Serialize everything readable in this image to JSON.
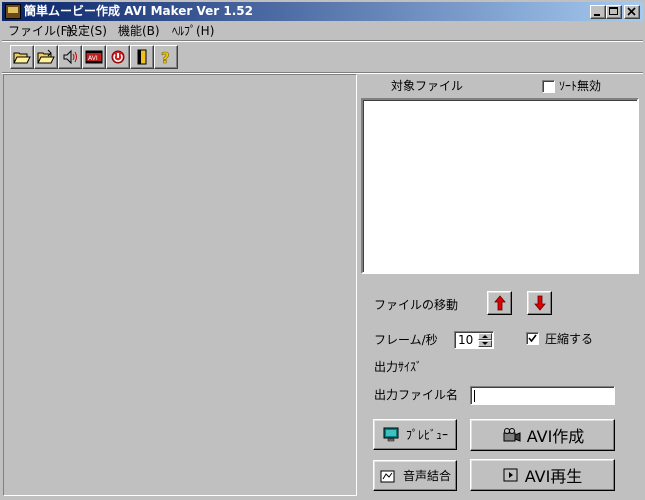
{
  "window": {
    "title": "簡単ムービー作成  AVI Maker Ver 1.52",
    "controls": {
      "minimize": "_",
      "maximize": "□",
      "close": "×"
    }
  },
  "menu": [
    {
      "label": "ファイル(F)",
      "name": "menu-file"
    },
    {
      "label": "設定(S)",
      "name": "menu-settings"
    },
    {
      "label": "機能(B)",
      "name": "menu-function"
    },
    {
      "label": "ﾍﾙﾌﾟ(H)",
      "name": "menu-help"
    }
  ],
  "toolbar": [
    {
      "icon": "open-folder-icon"
    },
    {
      "icon": "open-folder-alt-icon"
    },
    {
      "icon": "speaker-icon"
    },
    {
      "icon": "film-avi-icon"
    },
    {
      "icon": "reset-icon"
    },
    {
      "icon": "exit-door-icon"
    },
    {
      "icon": "help-question-icon"
    }
  ],
  "file_list": {
    "header": "対象ファイル",
    "sort_disable_label": "ｿｰﾄ無効",
    "sort_disable_checked": false,
    "items": []
  },
  "move": {
    "label": "ファイルの移動"
  },
  "fps": {
    "label": "フレーム/秒",
    "value": "10"
  },
  "compress": {
    "label": "圧縮する",
    "checked": true
  },
  "output_size": {
    "label": "出力ｻｲｽﾞ"
  },
  "output_filename": {
    "label": "出力ファイル名",
    "value": ""
  },
  "buttons": {
    "preview": "ﾌﾟﾚﾋﾞｭｰ",
    "create_avi": "AVI作成",
    "audio_merge": "音声結合",
    "play_avi": "AVI再生"
  },
  "colors": {
    "title_active": "#0a246a",
    "title_gradient_end": "#a6caf0",
    "face": "#c0c0c0",
    "arrow_red": "#e00000"
  }
}
